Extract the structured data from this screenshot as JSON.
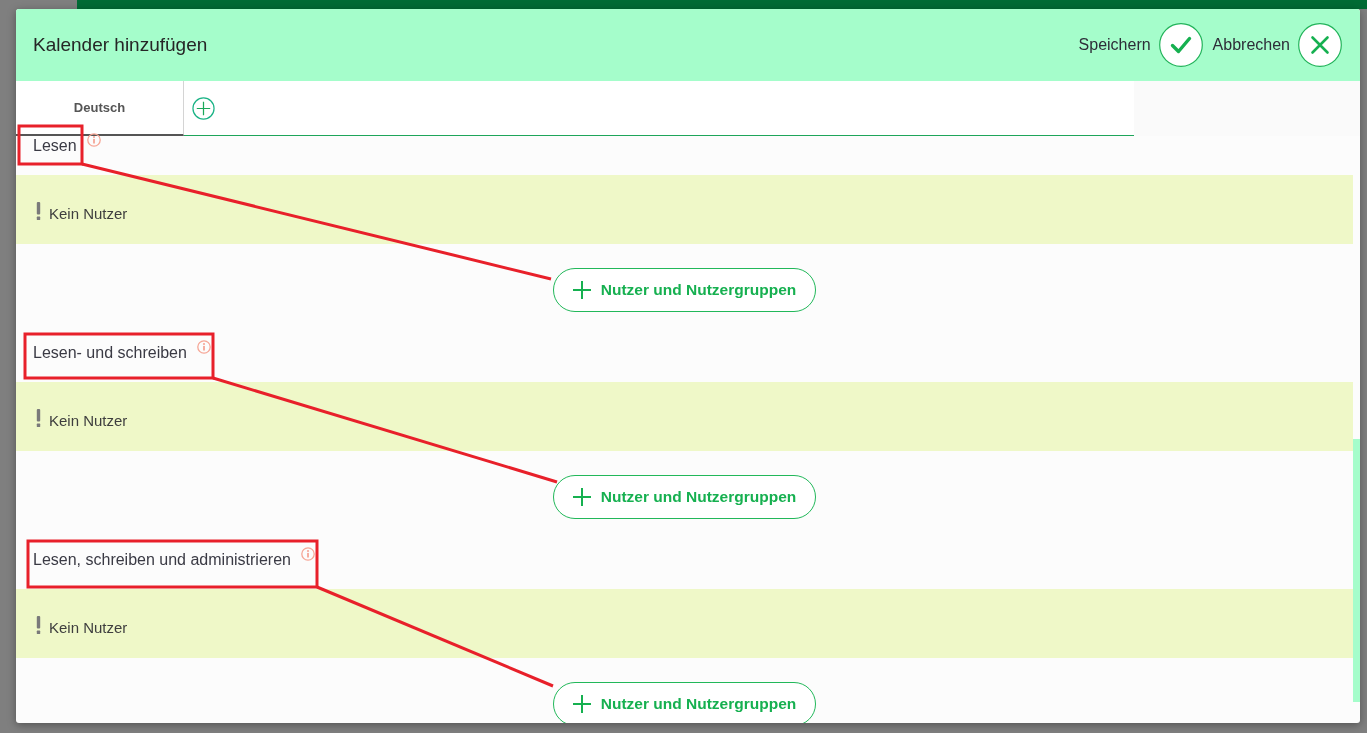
{
  "dialog": {
    "title": "Kalender hinzufügen",
    "actions": [
      {
        "kind": "save",
        "label": "Speichern"
      },
      {
        "kind": "cancel",
        "label": "Abbrechen"
      }
    ]
  },
  "tabs": [
    {
      "label": "Deutsch",
      "selected": true
    }
  ],
  "sections": [
    {
      "title": "Lesen",
      "highlighted": true,
      "notice": "Kein Nutzer",
      "add_button": "Nutzer und Nutzergruppen"
    },
    {
      "title": "Lesen- und schreiben",
      "highlighted": true,
      "notice": "Kein Nutzer",
      "add_button": "Nutzer und Nutzergruppen"
    },
    {
      "title": "Lesen, schreiben und administrieren",
      "highlighted": true,
      "notice": "Kein Nutzer",
      "add_button": "Nutzer und Nutzergruppen"
    }
  ]
}
